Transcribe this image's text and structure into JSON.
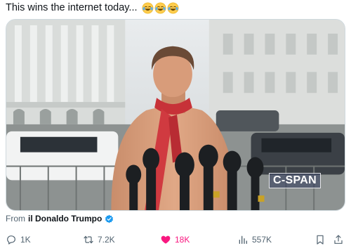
{
  "post": {
    "text": "This wins the internet today...",
    "emojis": [
      "laughing-emoji",
      "laughing-emoji",
      "laughing-emoji"
    ]
  },
  "media": {
    "watermark": "C-SPAN"
  },
  "source": {
    "from_label": "From",
    "handle": "il Donaldo Trumpo",
    "verified": true
  },
  "actions": {
    "replies": "1K",
    "reposts": "7.2K",
    "likes": "18K",
    "views": "557K"
  },
  "colors": {
    "like": "#f91880",
    "verified": "#1d9bf0",
    "muted": "#536471"
  }
}
